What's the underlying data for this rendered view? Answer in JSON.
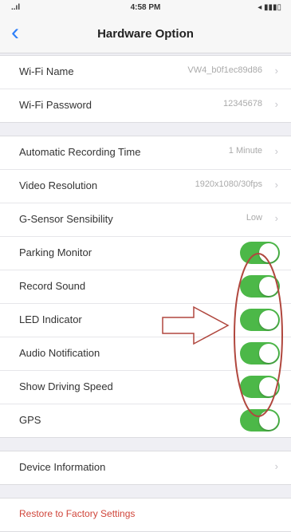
{
  "status_bar": {
    "time": "4:58 PM",
    "signal": "..ıl",
    "battery": "◂ ▮▮▮▯"
  },
  "nav": {
    "title": "Hardware Option",
    "back_icon": "chevron-left-icon"
  },
  "wifi": {
    "name_label": "Wi-Fi Name",
    "name_value": "VW4_b0f1ec89d86",
    "password_label": "Wi-Fi Password",
    "password_value": "12345678"
  },
  "settings": {
    "recording_label": "Automatic Recording Time",
    "recording_value": "1 Minute",
    "resolution_label": "Video Resolution",
    "resolution_value": "1920x1080/30fps",
    "gsensor_label": "G-Sensor Sensibility",
    "gsensor_value": "Low",
    "toggles": [
      {
        "label": "Parking Monitor",
        "on": true
      },
      {
        "label": "Record Sound",
        "on": true
      },
      {
        "label": "LED Indicator",
        "on": true
      },
      {
        "label": "Audio Notification",
        "on": true
      },
      {
        "label": "Show Driving Speed",
        "on": true
      },
      {
        "label": "GPS",
        "on": true
      }
    ]
  },
  "device": {
    "label": "Device Information"
  },
  "restore": {
    "label": "Restore to Factory Settings"
  },
  "colors": {
    "toggle_on": "#4cb848",
    "accent": "#2d7ff9",
    "restore": "#d0453a",
    "annotation": "#b0473e"
  }
}
